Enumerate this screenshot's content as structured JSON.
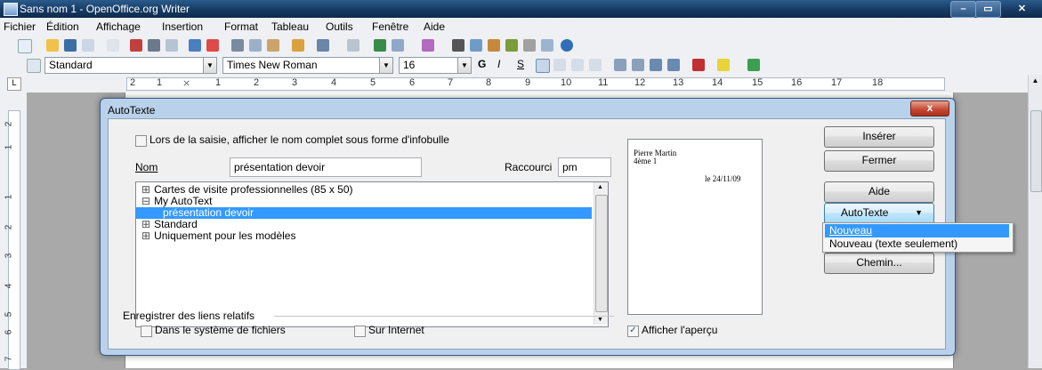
{
  "window": {
    "title": "Sans nom 1 - OpenOffice.org Writer"
  },
  "menubar": [
    "Fichier",
    "Édition",
    "Affichage",
    "Insertion",
    "Format",
    "Tableau",
    "Outils",
    "Fenêtre",
    "Aide"
  ],
  "format_toolbar": {
    "style": "Standard",
    "font": "Times New Roman",
    "size": "16",
    "bold": "G",
    "italic": "I",
    "underline": "S"
  },
  "ruler": {
    "marks": [
      "2",
      "1",
      "1",
      "2",
      "3",
      "4",
      "5",
      "6",
      "7",
      "8",
      "9",
      "10",
      "11",
      "12",
      "13",
      "14",
      "15",
      "16",
      "17",
      "18"
    ]
  },
  "vruler": {
    "marks": [
      "2",
      "1",
      "1",
      "2",
      "3",
      "4",
      "5",
      "6",
      "7"
    ]
  },
  "dialog": {
    "title": "AutoTexte",
    "close": "x",
    "show_tooltip_label": "Lors de la saisie, afficher le nom complet sous forme d'infobulle",
    "name_label": "Nom",
    "name_value": "présentation devoir",
    "shortcut_label": "Raccourci",
    "shortcut_value": "pm",
    "tree": [
      {
        "label": "Cartes de visite professionnelles (85 x 50)",
        "expander": "⊞"
      },
      {
        "label": "My AutoText",
        "expander": "⊟"
      },
      {
        "label": "présentation devoir",
        "expander": ""
      },
      {
        "label": "Standard",
        "expander": "⊞"
      },
      {
        "label": "Uniquement pour les modèles",
        "expander": "⊞"
      }
    ],
    "preview": {
      "line1": "Pierre Martin",
      "line2": "4ème 1",
      "line3": "le 24/11/09"
    },
    "buttons": {
      "insert": "Insérer",
      "close": "Fermer",
      "help": "Aide",
      "autotext": "AutoTexte",
      "path": "Chemin..."
    },
    "autotext_menu": [
      "Nouveau",
      "Nouveau (texte seulement)"
    ],
    "relative_links_label": "Enregistrer des liens relatifs",
    "filesystem_label": "Dans le système de fichiers",
    "internet_label": "Sur Internet",
    "show_preview_label": "Afficher l'aperçu",
    "show_preview_checked": true
  },
  "colors": {
    "titlebar": "#173a63",
    "selection": "#3399ff",
    "dialog_frame": "#b9d1ea"
  }
}
